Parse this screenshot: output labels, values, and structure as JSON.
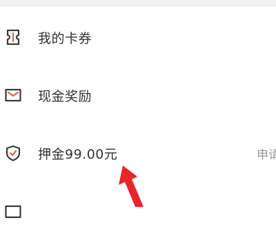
{
  "menu": {
    "items": [
      {
        "label": "我的卡券",
        "icon": "ticket-icon"
      },
      {
        "label": "现金奖励",
        "icon": "envelope-icon"
      },
      {
        "label": "押金99.00元",
        "icon": "shield-check-icon",
        "action_label": "申请"
      },
      {
        "label": "",
        "icon": "envelope-icon"
      }
    ]
  },
  "annotation": {
    "color": "#e8252b",
    "icon": "red-arrow-pointer"
  },
  "colors": {
    "icon_stroke": "#3a3a3a",
    "icon_accent": "#e35a4f",
    "text": "#333333",
    "muted_text": "#999999"
  }
}
